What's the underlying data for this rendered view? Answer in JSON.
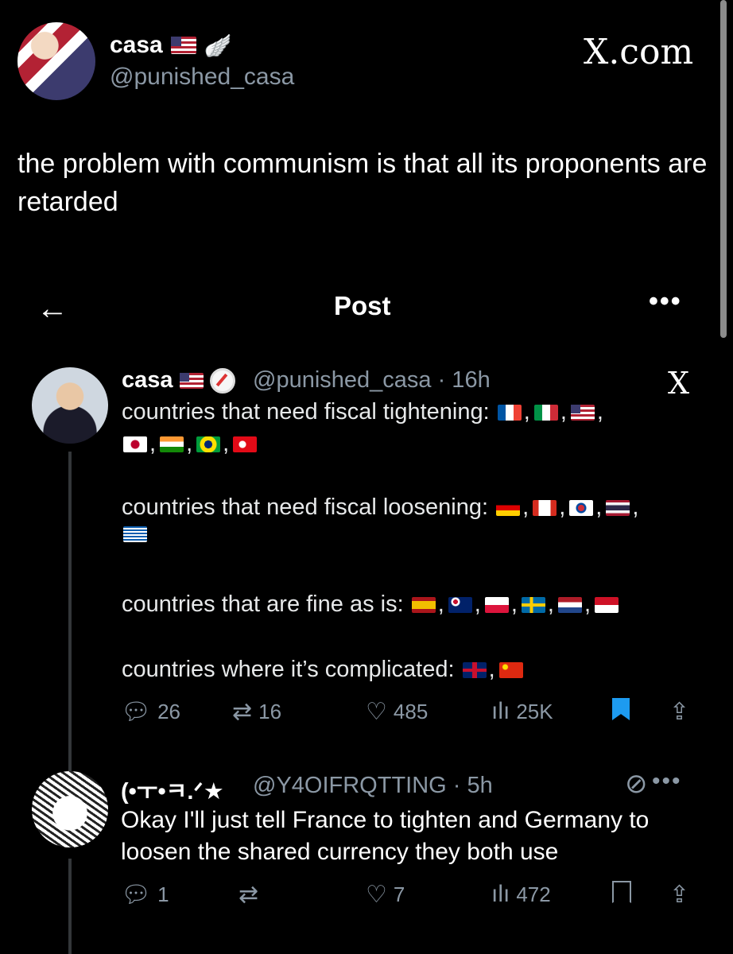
{
  "outer": {
    "name": "casa",
    "name_badges": [
      "us-flag",
      "wing-emoji"
    ],
    "handle": "@punished_casa",
    "source_logo": "X.com",
    "tweet": "the problem with communism is that all its proponents are retarded"
  },
  "header": {
    "back": "←",
    "title": "Post",
    "more": "•••"
  },
  "post": {
    "name": "casa",
    "handle_time": "@punished_casa · 16h",
    "watermark": "X",
    "lines": [
      {
        "text": "countries that need fiscal tightening:",
        "flags": [
          "fr",
          "it",
          "us"
        ]
      },
      {
        "text": "",
        "flags": [
          "jp",
          "in",
          "br",
          "tr"
        ]
      },
      {
        "text": "countries that need fiscal loosening:",
        "flags": [
          "de",
          "ca",
          "kr",
          "th"
        ]
      },
      {
        "text": "",
        "flags": [
          "gr"
        ]
      },
      {
        "text": "countries that are fine as is:",
        "flags": [
          "es",
          "au",
          "pl",
          "se",
          "nl",
          "id"
        ]
      },
      {
        "text": "countries where it’s complicated:",
        "flags": [
          "gb",
          "cn"
        ]
      }
    ],
    "stats": {
      "replies": "26",
      "reposts": "16",
      "likes": "485",
      "views": "25K"
    },
    "colors": {
      "bookmark": "#1d9bf0"
    }
  },
  "reply": {
    "name": "(•ㅜ•ㅋ.ᐟ★",
    "handle_time": "@Y4OIFRQTTING · 5h",
    "text": "Okay I'll just tell France to tighten and Germany to loosen the shared currency they both use",
    "stats": {
      "replies": "1",
      "reposts": "",
      "likes": "7",
      "views": "472"
    }
  }
}
